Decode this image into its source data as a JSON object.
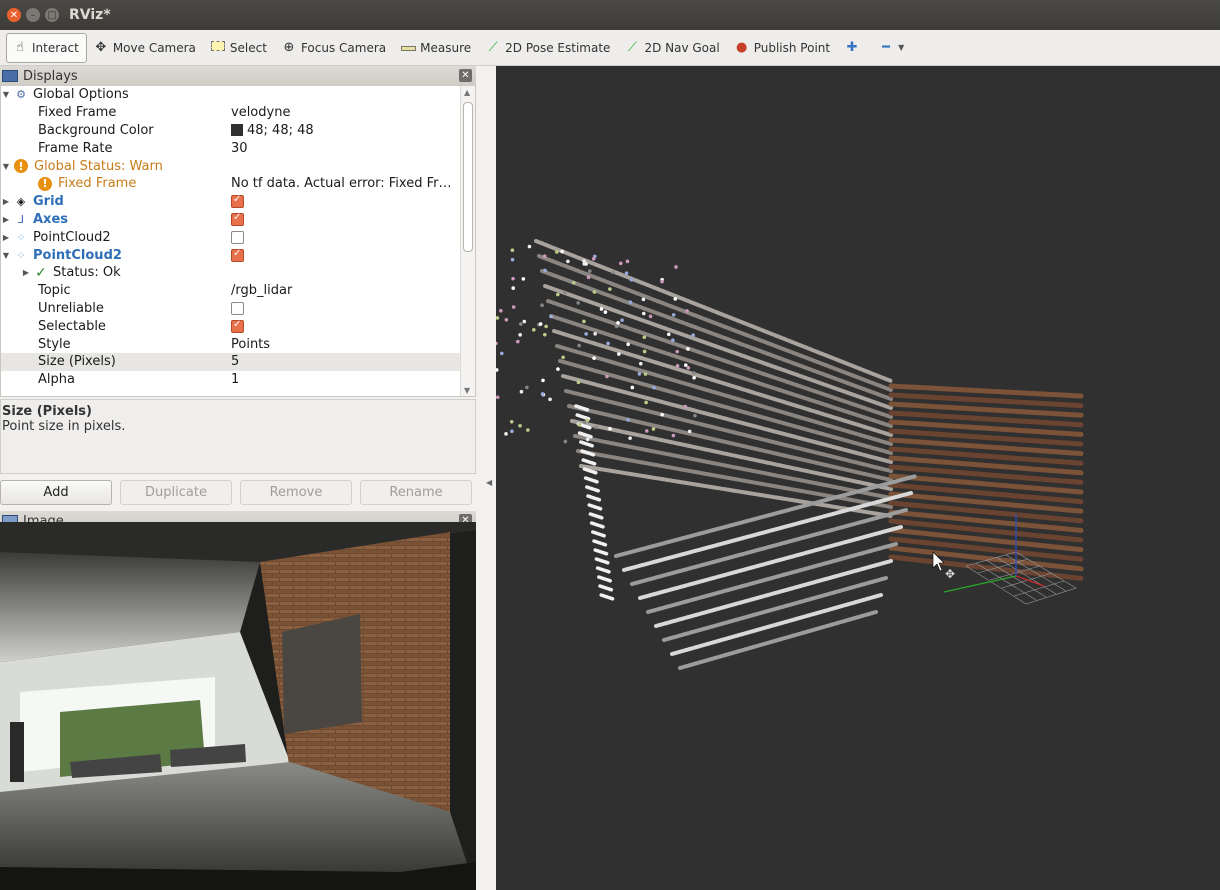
{
  "window": {
    "title": "RViz*"
  },
  "toolbar": {
    "items": [
      {
        "label": "Interact",
        "icon": "hand-icon"
      },
      {
        "label": "Move Camera",
        "icon": "move-camera-icon"
      },
      {
        "label": "Select",
        "icon": "select-icon"
      },
      {
        "label": "Focus Camera",
        "icon": "focus-camera-icon"
      },
      {
        "label": "Measure",
        "icon": "measure-icon"
      },
      {
        "label": "2D Pose Estimate",
        "icon": "pose-arrow-icon"
      },
      {
        "label": "2D Nav Goal",
        "icon": "nav-goal-arrow-icon"
      },
      {
        "label": "Publish Point",
        "icon": "map-pin-icon"
      }
    ]
  },
  "displays": {
    "title": "Displays",
    "rows": [
      {
        "name": "Global Options",
        "value": ""
      },
      {
        "name": "Fixed Frame",
        "value": "velodyne"
      },
      {
        "name": "Background Color",
        "value": "48; 48; 48"
      },
      {
        "name": "Frame Rate",
        "value": "30"
      },
      {
        "name": "Global Status: Warn",
        "value": ""
      },
      {
        "name": "Fixed Frame",
        "value": "No tf data.  Actual error: Fixed Fr…"
      },
      {
        "name": "Grid",
        "value": ""
      },
      {
        "name": "Axes",
        "value": ""
      },
      {
        "name": "PointCloud2",
        "value": ""
      },
      {
        "name": "PointCloud2",
        "value": ""
      },
      {
        "name": "Status: Ok",
        "value": ""
      },
      {
        "name": "Topic",
        "value": "/rgb_lidar"
      },
      {
        "name": "Unreliable",
        "value": ""
      },
      {
        "name": "Selectable",
        "value": ""
      },
      {
        "name": "Style",
        "value": "Points"
      },
      {
        "name": "Size (Pixels)",
        "value": "5"
      },
      {
        "name": "Alpha",
        "value": "1"
      }
    ],
    "description_title": "Size (Pixels)",
    "description_text": "Point size in pixels.",
    "buttons": {
      "add": "Add",
      "duplicate": "Duplicate",
      "remove": "Remove",
      "rename": "Rename"
    }
  },
  "image_panel": {
    "title": "Image"
  },
  "colors": {
    "background": "#303030",
    "warn": "#c77c18",
    "accent_blue": "#2e6fb7"
  }
}
